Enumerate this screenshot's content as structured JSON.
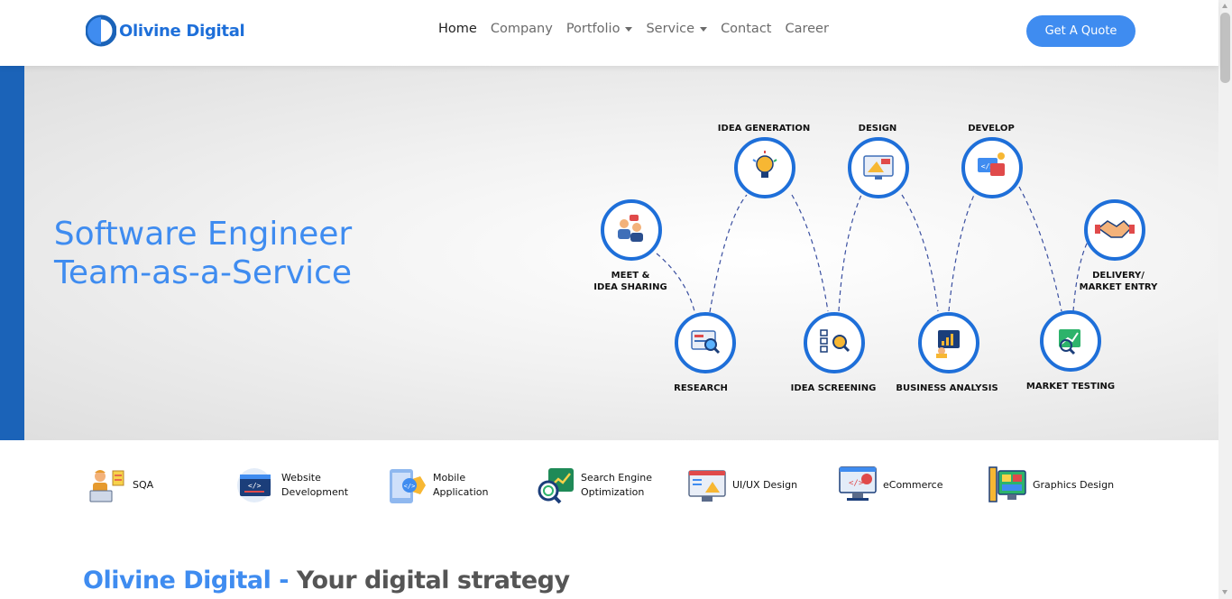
{
  "brand": {
    "name": "Olivine Digital"
  },
  "nav": {
    "items": [
      {
        "label": "Home",
        "active": true,
        "dropdown": false
      },
      {
        "label": "Company",
        "active": false,
        "dropdown": false
      },
      {
        "label": "Portfolio",
        "active": false,
        "dropdown": true
      },
      {
        "label": "Service",
        "active": false,
        "dropdown": true
      },
      {
        "label": "Contact",
        "active": false,
        "dropdown": false
      },
      {
        "label": "Career",
        "active": false,
        "dropdown": false
      }
    ],
    "cta_label": "Get A Quote"
  },
  "hero": {
    "title_line1": "Software Engineer",
    "title_line2": "Team-as-a-Service",
    "steps": [
      {
        "label": "MEET &\nIDEA SHARING",
        "icon": "meeting-icon"
      },
      {
        "label": "RESEARCH",
        "icon": "research-icon"
      },
      {
        "label": "IDEA GENERATION",
        "icon": "lightbulb-icon"
      },
      {
        "label": "IDEA SCREENING",
        "icon": "screening-icon"
      },
      {
        "label": "DESIGN",
        "icon": "design-icon"
      },
      {
        "label": "BUSINESS ANALYSIS",
        "icon": "analysis-icon"
      },
      {
        "label": "DEVELOP",
        "icon": "develop-icon"
      },
      {
        "label": "MARKET TESTING",
        "icon": "testing-icon"
      },
      {
        "label": "DELIVERY/\nMARKET ENTRY",
        "icon": "handshake-icon"
      }
    ]
  },
  "services": [
    {
      "label": "SQA",
      "icon": "sqa-icon"
    },
    {
      "label": "Website\nDevelopment",
      "icon": "website-icon"
    },
    {
      "label": "Mobile\nApplication",
      "icon": "mobile-app-icon"
    },
    {
      "label": "Search Engine\nOptimization",
      "icon": "seo-icon"
    },
    {
      "label": "UI/UX Design",
      "icon": "uiux-icon"
    },
    {
      "label": "eCommerce",
      "icon": "ecommerce-icon"
    },
    {
      "label": "Graphics Design",
      "icon": "graphics-icon"
    }
  ],
  "section": {
    "heading_brand": "Olivine Digital -",
    "heading_rest": "Your digital strategy"
  },
  "colors": {
    "primary": "#3f8cf0",
    "hero_bar": "#1b63b8",
    "ring": "#1e6fd9"
  }
}
